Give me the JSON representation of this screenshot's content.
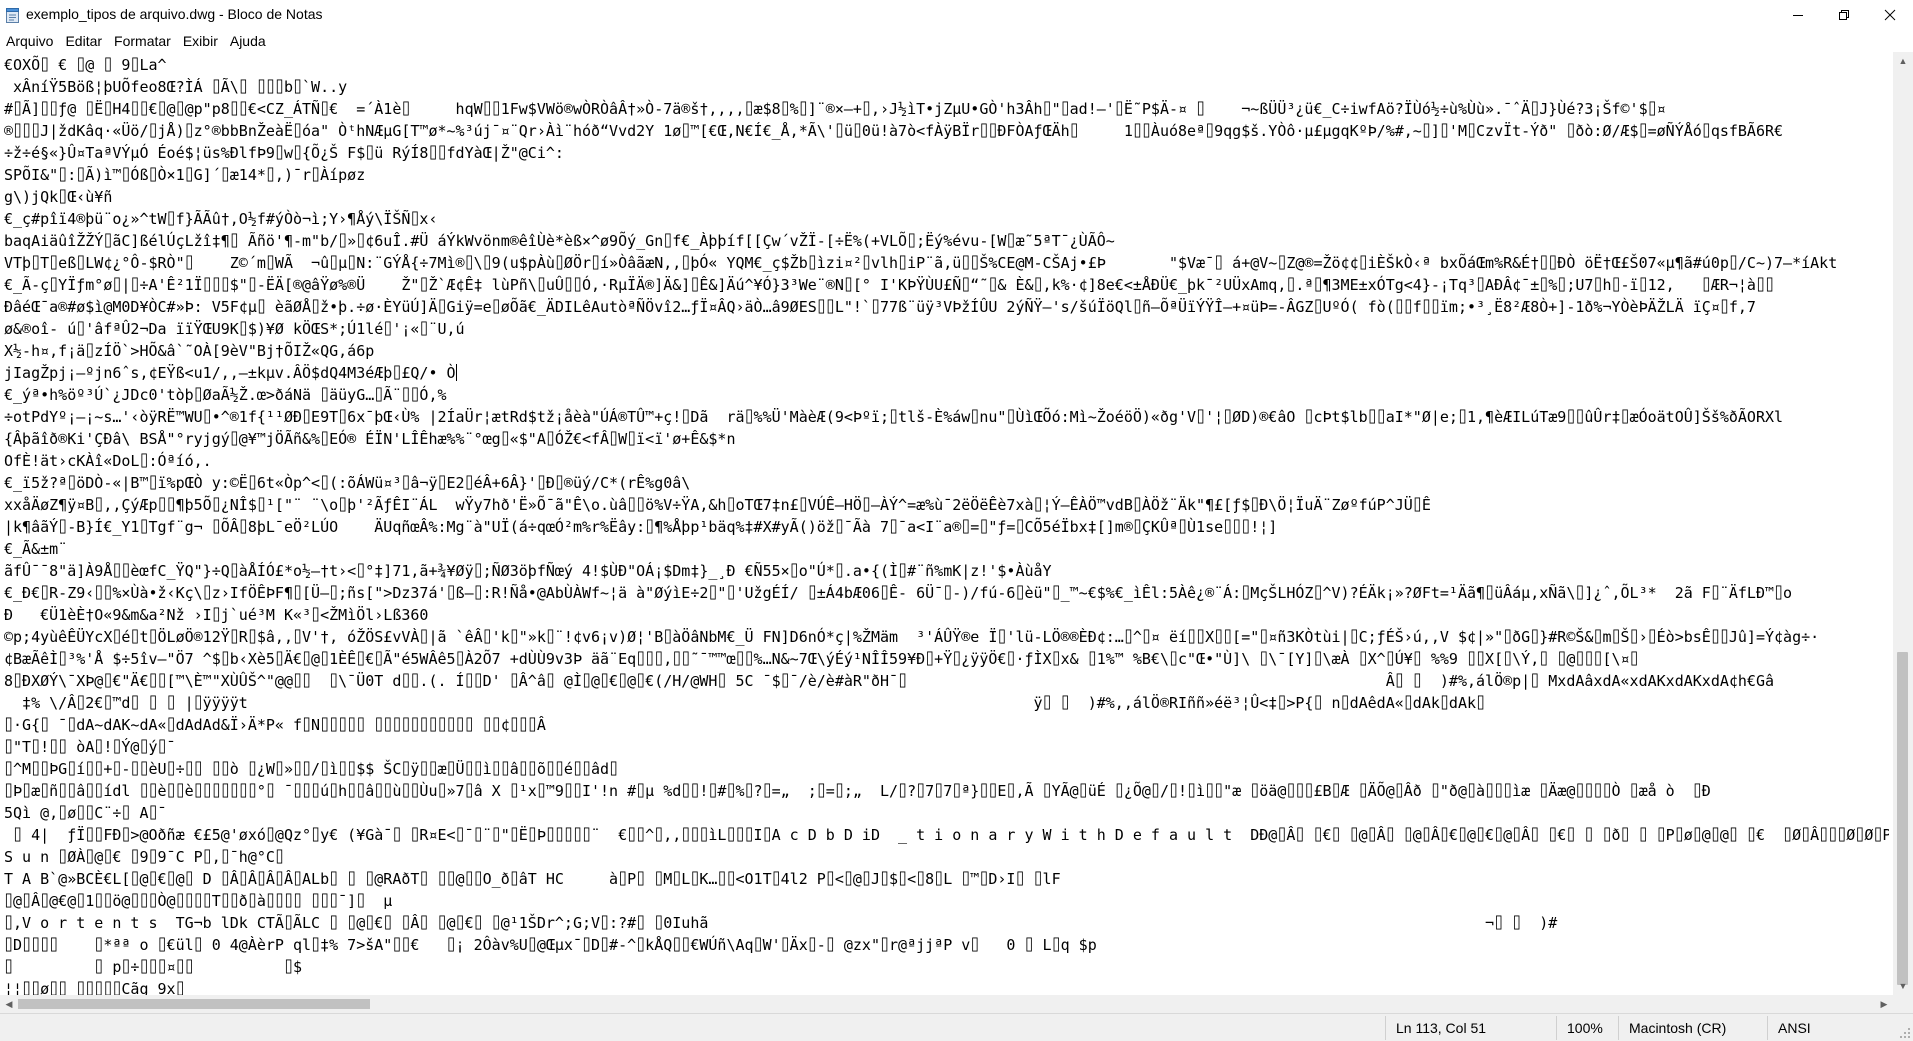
{
  "window": {
    "title": "exemplo_tipos de arquivo.dwg - Bloco de Notas",
    "minimize_icon": "minimize-icon",
    "maximize_icon": "maximize-icon",
    "close_icon": "close-icon"
  },
  "menu": {
    "items": [
      "Arquivo",
      "Editar",
      "Formatar",
      "Exibir",
      "Ajuda"
    ]
  },
  "editor": {
    "lines": [
      "€OXÕ⌷ € ⌷@ ⌷ 9⌷La^",
      " xÂníŸ5Böß¦þUÕfeo8Œ?ÌÁ ⌷Ã\\⌷ ⌷⌷⌷b⌷`W..y",
      "#⌷Ã]⌷⌷ƒ@ ⌷Ë⌷H4⌷⌷€⌷@⌷@p\"p8⌷⌷€<CZ_ÁTÑ⌷€  =´À1è⌷     hqW⌷⌷1Fw$VWö®wÒRÒâÂ†»Ò-7ä®š†,,,,⌷æ$8⌷%⌷]¨®×—+⌷,›J½ìT•jZµU•GÒ'h3Âh⌷\"⌷ad!—'⌷Ë˜P$Ä-¤ ⌷    ¬~ßÜÜ³¿ü€_C÷iwfAö?ÏÙó½÷ù%Ùù».¯ˆÄ⌷J}Ùé?3¡Šf©'$⌷¤",
      "®⌷⌷⌷J|ždKâq·«Üö/⌷jÅ)⌷z°®bbBnŽeàË⌷óa\" ÒᵗhNÆµG[T™ø*~%³új¯¤¨Qr›Àì¨hóð“Vvd2Y 1ø⌷™[€Œ,N€Í€_Å,*Ã\\'⌷ü⌷0ü!à7ò<fÀÿBÏr⌷⌷ÐFÒAƒŒÄh⌷     1⌷⌷Àuó8eª⌷9qg$š.YÒô·µ£µgqKºÞ/%#,~⌷]⌷'M⌷CzvÏt-Ýð\" ⌷ðò:Ø/Æ$⌷=øÑÝÅó⌷qsfBÃ6R€",
      "÷ž÷é§«}Û¤TaªVÝµÓ Éoé$¦üs%ÐlfÞ9⌷w⌷{Õ¿Š F$⌷ü RýÍ8⌷⌷fdYàŒ|Ž\"@Ci^:",
      "SPÕI&\"⌷:⌷Ã)ì™⌷Óß⌷Ò×1⌷G]´⌷æ14*⌷,)¯r⌷Àípøz",
      "g\\)jQk⌷Œ‹ù¥ñ",
      "€_ç#pîï4®þü¨o¿»^tW⌷f}ÃÃû†,O½f#ýÒò¬ì;Y›¶Åý\\ÏŠÑ⌷x‹",
      "baqAiäûîŽŽÝ⌷ãC]ßélÚçLžî‡¶⌷ Ãñö'¶-m\"b/⌷»⌷¢6uÎ.#Ü áÝkWvönm®êîÙè*èß×^ø9Õý_Gn⌷f€_Àþþíf[[Çw´vŽÏ-[÷Ë%(+VLÕ⌷;Ëý%évu-[W⌷æ˜5ªT¯¿ÙÃÔ~",
      "VTþ⌷T⌷eß⌷LW¢¿°Ô-$RÒ\"⌷    Z©´m⌷WÃ  ¬û⌷µ⌷N:¨GÝÅ{÷7Mì®⌷\\⌷9(u$pÀù⌷ØÖr⌷í»ÒâãæN,,⌷þÓ« YQM€_ç$Žb⌷ìzi¤²⌷vlh⌷iP¨ã,ü⌷⌷Š%CE@M-CŠAj•£Þ       \"$Væ¯⌷ á+@V~⌷Z@®=Žö¢¢⌷iÈŠkÒ‹ª bxÕáŒm%R&É†⌷⌷ÐÒ öË†Œ£Š07«µ¶ã#ú0p⌷/C~)7–*íAkt",
      "€_Ã-ç⌷YÏƒm°ø⌷|⌷÷A'Ê²1Ï⌷⌷⌷$\"⌷-ËÄ[®@âŸø%®Ü    Ž\"⌷Ž`Æ¢Ê‡ lùPñ\\⌷uÛ⌷⌷Ó,·RµÏÄ®]Ä&]⌷Ê&]Äú^¥Ó}3³We¨®N⌷[° I'KÞŸÙU£Ñ⌷“˜⌷& È&⌷,k%·¢]8e€<±ÅÐÜ€_þk¯²UÜxAmq,⌷.ª⌷¶3ME±xÓTg<4}-¡Tq³⌷AÐÂ¢¯±⌷%⌷;U7⌷h⌷-ï⌷12,   ⌷ÆR¬¦à⌷⌷",
      "ÐâéŒ¯a®#ø$ì@M0D¥ÒC#»Þ: V5F¢µ⌷ èãØÅ⌷ž•þ.÷ø·ÈYüÚ]Ä⌷Giÿ=e⌷øÕã€_ÄDILêAutòªÑÖvî2…ƒÏ¤ÂQ›äÒ…â9ØES⌷⌷L\"!`⌷77ß¨üÿ³VÞžÍÛU 2ýÑŸ–'s/šúÏöQl⌷ñ–ÕªÜïÝŸÎ–+¤üÞ=-ÂGZ⌷UºÓ( fò(⌷⌷f⌷⌷ïm;•³¸Ë8²Æ8Ò+]-1ð%¬YÒèÞÄŽLÄ ïÇ¤⌷f,7",
      "ø&®oî- ú⌷'âfªÛ2¬Da ïïŸŒU9K⌷$)¥Ø kÖŒS*;Ú1lé⌷'¡«⌷¨U,ú",
      "X½-h¤,f¡ä⌷zÍÖ`>HÕ&â`˜OÀ[9èV\"Bj†ÕIŽ«QG,á6p",
      "jIagŽpj¡—ºjn6ˆs,¢EŸß<u1/,,—±kµv.ÂÖ$dQ4M3éÆþ⌷£Q/• Ò",
      "€_ýª•h%öº³Ú`¿JDc0'tòþ⌷ØaÃ½Ž.œ>ðáNä ⌷äüyG…⌷Ã¨⌷⌷Ó,%",
      "÷otPdYº¡—¡~s…'‹òÿRË™WU⌷•^®1f{¹¹ØÐ⌷E9T⌷6x¯þŒ‹Ù% |2ÍaÜr¦ætRd$tž¡åèà\"ÚÁ®TÛ™+ç!⌷Dã  rä⌷%%Ü'MàèÆ(9<Þºï;⌷tlš-È%áw⌷nu\"⌷ÙìŒÕó:Mì~ŽoéöÖ)«ðg'V⌷'¦⌷ØD)®€âO ⌷cÞt$lb⌷⌷aI*\"Ø|e;⌷1,¶èÆILúTæ9⌷⌷ûÛr‡⌷æÓoätOÛ]Šš%ðÃORXl",
      "{Âþãîð®Ki'ÇÐâ\\ BSÅ\"°ryjgý⌷@¥™jÖÃñ&%⌷EÓ® ÉÏN'LÎÊhæ%%¨°œg⌷«$\"A⌷ÓŽ€<fÂ⌷W⌷ï<ï'ø+Ê&$*n",
      "OfÈ!ät›cKÀî«DoL⌷:Óªíó,.",
      "€_ï5ž?ª⌷öDÒ-«|B™⌷ï%pŒÒ y:©Ë⌷6t«Òp^<⌷(:õÁWü¤³⌷â¬ÿ⌷E2⌷éÂ+6Â}'⌷Ð⌷®üý/C*(rÊ%g0â\\",
      "xxåÄøZ¶ÿ¤B⌷,,ÇýÆp⌷⌷¶þ5Õ⌷¿NÎ$⌷¹[\"¨ ¨\\o⌷þ'²ÃƒÊI¨ÁL  wŸy7hð'Ë»Õ¯ã\"Ê\\o.ùâ⌷⌷ö%V÷ŸA,&h⌷oTŒ7‡n£⌷VÚÊ—HÖ⌷—ÀÝ^=æ%ù¯2ëÖëÊè7xà⌷¦Ý—ÊÀÖ™vdB⌷ÀÖž¨Äk\"¶£[ƒ$⌷Ð\\Ö¦ÏuÄ¨ZøºfúP^JÜ⌷Ê",
      "|k¶âãÝ⌷-B}Í€_Y1⌷Tgf¨g¬ ⌷ÕÂ⌷8þL¯eÖ²LÚO    ÄUqñœÂ%:Mg¨à\"UÏ(á÷qœÓ²m%r%Ëây:⌷¶%Åþp¹bäq%‡#X#yÃ()öž⌷¯Ãà 7⌷¯a<I¨a®⌷=⌷\"ƒ=⌷CÕ5éÏbx‡[]m®⌷ÇKÛª⌷Ù1se⌷⌷⌷!¦]",
      "€_Ã&±m¨",
      "ãfÛ¯¯8\"ä]À9Å⌷⌷èœfC_ŸQ\"}÷Q⌷àÅÍÓ£*o½—†t›<⌷°‡]71,ã+¾¥Øÿ⌷;ÑØ3öþfÑœý 4!$ÙÐ\"OÁ¡$Dm‡}_¸Ð €Ñ55×⌷o\"Ú*⌷.a•{(Ì⌷#¨ñ%mK|z!'$•ÀùåY",
      "€_Ð€⌷R-Z9‹⌷⌷%×Ùà•ž‹Kç\\⌷z›IfÖÊÞF¶⌷[Ü—⌷;ñs[\">Dz37á'⌷ß—⌷:R!Ñå•@AbÙÀWf~¦ä à\"ØýìE÷2⌷\"⌷'UžgÉÍ/ ⌷±Á4bÆ06⌷Ê- 6Ü¯⌷-)/fú-6⌷èü\"⌷_™~€$%€_ìÊl:5Àê¿®¨Á:⌷MçŠLHÓZ⌷^V)?ÉÄk¡»?ØFt=¹Äã¶⌷üÂáµ,xÑã\\⌷]¿ˆ,ÕL³*  2ã F⌷¨ÄfLÐ™⌷o",
      "Ð   €Ü1èÈ†O«9&m&a²Nž ›I⌷j`ué³M K«³⌷<ŽMìÖl›Lß360",
      "©p;4yùêÊÜYcX⌷é⌷t⌷ÖLøÖ®12Ÿ⌷R⌷$â,,⌷V'†, óŽÖS£vVÀ⌷|ã `êÂ⌷'k⌷\"»k⌷¨!¢v6¡v)Ø¦'B⌷àÖâNbM€_Ü FN]D6nÓ*ç|%ŽMäm  ³'ÁÛŸ®e Ï⌷'lü-LÖ®®ÈÐ¢:…⌷^⌷¤ ëí⌷⌷X⌷⌷[=\"⌷¤ñ3KÒtùi|⌷C;ƒÉŠ›ú,,V $¢|»\"⌷ðG⌷}#R©Š&⌷m⌷Š⌷›⌷Éò>bsÊ⌷⌷Jû]=Ý¢àg÷·",
      "¢BæÃêÌ⌷³%'Å $÷5îv–\"Ö7 ^$⌷b‹Xè5⌷Ä€⌷@⌷1ÈÊ⌷€⌷Ã\"é5WÂê5⌷À2Õ7 +dÙÙ9v3Þ äã¨Eq⌷⌷⌷,⌷⌷˜¯™™œ⌷⌷%…N&~7Œ\\ýÉý¹NÎÎ59¥Ð⌷+Ÿ⌷¿ÿÿÖ€⌷·ƒÌX⌷x& ⌷1%™ %B€\\⌷c\"Œ•\"Ù]\\ ⌷\\¯[Y]⌷\\æÀ ⌷X^⌷Ú¥⌷ %%9 ⌷⌷X[⌷\\Ý,⌷ ⌷@⌷⌷⌷[\\¤⌷",
      "8⌷ÐXØÝ\\¯XÞ@⌷€\"Ä€⌷⌷[™\\È™\"XÙÛŠ^\"@@⌷⌷  ⌷\\¯Ü0T d⌷⌷.(. Í⌷⌷D' ⌷Â^â⌷ @Ì⌷@⌷€⌷@⌷€(/H/@WH⌷ 5C ¯$⌷¯/è/è#àR\"ðH¯⌷                                                     Â⌷ ⌷  )#%,álÖ®p|⌷ MxdAâxdA«xdAKxdAKxdA¢h€Gâ",
      "  ‡% \\/Â⌷2€⌷™d⌷ ⌷ ⌷ |⌷ÿÿÿÿt                                                                                       ÿ⌷ ⌷  )#%,,álÖ®RIññ»éë³¦Û<‡⌷>P{⌷ n⌷dAêdA«⌷dAk⌷dAk⌷",
      "⌷·G{⌷ ¯⌷dA~dAK~dA«⌷dAdAd&Ï›Ä*P« f⌷N⌷⌷⌷⌷⌷ ⌷⌷⌷⌷⌷⌷⌷⌷⌷⌷⌷ ⌷⌷¢⌷⌷⌷Â",
      "⌷\"T⌷!⌷⌷ òA⌷!⌷Ý@⌷ý⌷¯",
      "⌷^M⌷⌷ÞG⌷í⌷⌷+⌷-⌷⌷èU⌷÷⌷⌷ ⌷⌷ò ⌷¿W⌷»⌷⌷/⌷ì⌷⌷$$ ŠC⌷ÿ⌷⌷æ⌷Ü⌷⌷ì⌷⌷â⌷⌷õ⌷⌷é⌷⌷âd⌷",
      "⌷Þ⌷æ⌷ñ⌷⌷â⌷⌷ídl ⌷⌷è⌷⌷è⌷⌷⌷⌷⌷⌷⌷°⌷ ¯⌷⌷⌷ú⌷h⌷⌷â⌷⌷ù⌷⌷Ùu⌷»7⌷â X ⌷¹x⌷™9⌷⌷I'!n #⌷µ %d⌷⌷!⌷#⌷%⌷?⌷=„  ;⌷=⌷;„  L/⌷?⌷7⌷7⌷ª}⌷⌷E⌷,Ã ⌷YÃ@⌷üÉ ⌷¿Õ@⌷/⌷!⌷ì⌷⌷\"æ ⌷öä@⌷⌷⌷£B⌷Æ ⌷ÄÕ@⌷Âð ⌷\"ð@⌷à⌷⌷⌷ìæ ⌷Äæ@⌷⌷⌷⌷Ò ⌷æå ò  ⌷Ð",
      "5Qì @,⌷ø⌷⌷C¨÷⌷ A⌷¯",
      " ⌷ 4|  ƒÏ⌷⌷FÐ⌷>@Oðñæ €£5@'øxó⌷@Qz°⌷y€ (¥Gà¯⌷ ⌷R¤E<⌷¯⌷¨⌷\"⌷Ë⌷Þ⌷⌷⌷⌷⌷¨  €⌷⌷^⌷,,⌷⌷⌷ìL⌷⌷⌷I⌷A c D b D iD  _ t i o n a r y W i t h D e f a u l t  DÐ@⌷Â⌷ ⌷€⌷ ⌷@⌷Â⌷ ⌷@⌷Â⌷€⌷@⌷€⌷@⌷Â⌷ ⌷€⌷ ⌷ ⌷ð⌷ ⌷ ⌷P⌷ø⌷@⌷@⌷ ⌷€  ⌷Ø⌷Â⌷⌷⌷Ø⌷Ø⌷P⌷Ø⌷=⌷I&⌷C)X⌷¤$@⌷",
      "S u n ⌷ØÀ⌷@⌷€ ⌷9⌷9¯C P⌷,⌷¯h@°C⌷",
      "T A B`@»BCÈ€L[⌷@⌷€⌷@⌷ D ⌷Â⌷Â⌷Â⌷Â⌷ALb⌷ ⌷ ⌷@RAðT⌷ ⌷⌷@⌷⌷O_ð⌷âT HC     à⌷P⌷ ⌷M⌷L⌷K…⌷⌷<O1T⌷4l2 P⌷<⌷@⌷J⌷$⌷<⌷8⌷L ⌷™⌷D›I⌷ ⌷lF",
      "⌷@⌷Â⌷@€@⌷1⌷⌷ö@⌷⌷⌷Ò@⌷⌷⌷⌷T⌷⌷ð⌷à⌷⌷⌷⌷ ⌷⌷⌷¯]⌷  µ",
      "⌷,V o r t e n t s  TG¬b lDk CTÃ⌷ÃLC ⌷ ⌷@⌷€⌷ ⌷Â⌷ ⌷@⌷€⌷ ⌷@¹1ŠDr^;G;V⌷:?#⌷ ⌷0Iuhã                                                                                      ¬⌷ ⌷  )#",
      "⌷D⌷⌷⌷⌷    ⌷*ªª o ⌷€ül⌷ 0 4@ÀèrP ql⌷‡% 7>šA\"⌷⌷€   ⌷¡ 2Ôàv%U⌷@Œµx¯⌷D⌷#-^⌷kÅQ⌷⌷€WÚñ\\Aq⌷W'⌷Äx⌷-⌷ @zx\"⌷r@ªjjªP v⌷   0 ⌷ L⌷q $p",
      "⌷         ⌷ p⌷÷⌷⌷⌷¤⌷⌷          ⌷$",
      "¦¦⌷⌷ø⌷⌷ ⌷⌷⌷⌷⌷Cãg 9x⌷"
    ]
  },
  "status": {
    "position": "Ln 113, Col 51",
    "zoom": "100%",
    "line_ending": "Macintosh (CR)",
    "encoding": "ANSI"
  },
  "colors": {
    "background": "#ffffff",
    "statusbar": "#f0f0f0",
    "scrollbar_thumb": "#c1c1c1",
    "text": "#000000"
  }
}
